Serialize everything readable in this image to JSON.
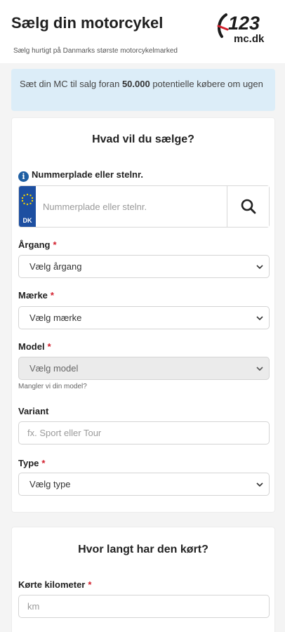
{
  "header": {
    "title": "Sælg din motorcykel",
    "subtitle": "Sælg hurtigt på Danmarks største motorcykelmarked",
    "logo_number": "123",
    "logo_domain": "mc.dk"
  },
  "banner": {
    "text_before": "Sæt din MC til salg foran ",
    "highlight": "50.000",
    "text_after": " potentielle købere om ugen"
  },
  "sell_card": {
    "title": "Hvad vil du sælge?",
    "plate_label": "Nummerplade eller stelnr.",
    "plate_placeholder": "Nummerplade eller stelnr.",
    "plate_country": "DK",
    "year_label": "Årgang",
    "year_select": "Vælg årgang",
    "make_label": "Mærke",
    "make_select": "Vælg mærke",
    "model_label": "Model",
    "model_select": "Vælg model",
    "model_missing_link": "Mangler vi din model?",
    "variant_label": "Variant",
    "variant_placeholder": "fx. Sport eller Tour",
    "type_label": "Type",
    "type_select": "Vælg type",
    "required_mark": "*"
  },
  "distance_card": {
    "title": "Hvor langt har den kørt?",
    "km_label": "Kørte kilometer",
    "km_placeholder": "km"
  },
  "colors": {
    "banner_bg": "#dcedf8",
    "required": "#d21f2c",
    "eu_blue": "#1d4fa1",
    "logo_red": "#d21f2c"
  },
  "icons": [
    "info-icon",
    "search-icon",
    "chevron-down-icon",
    "eu-flag-icon"
  ]
}
